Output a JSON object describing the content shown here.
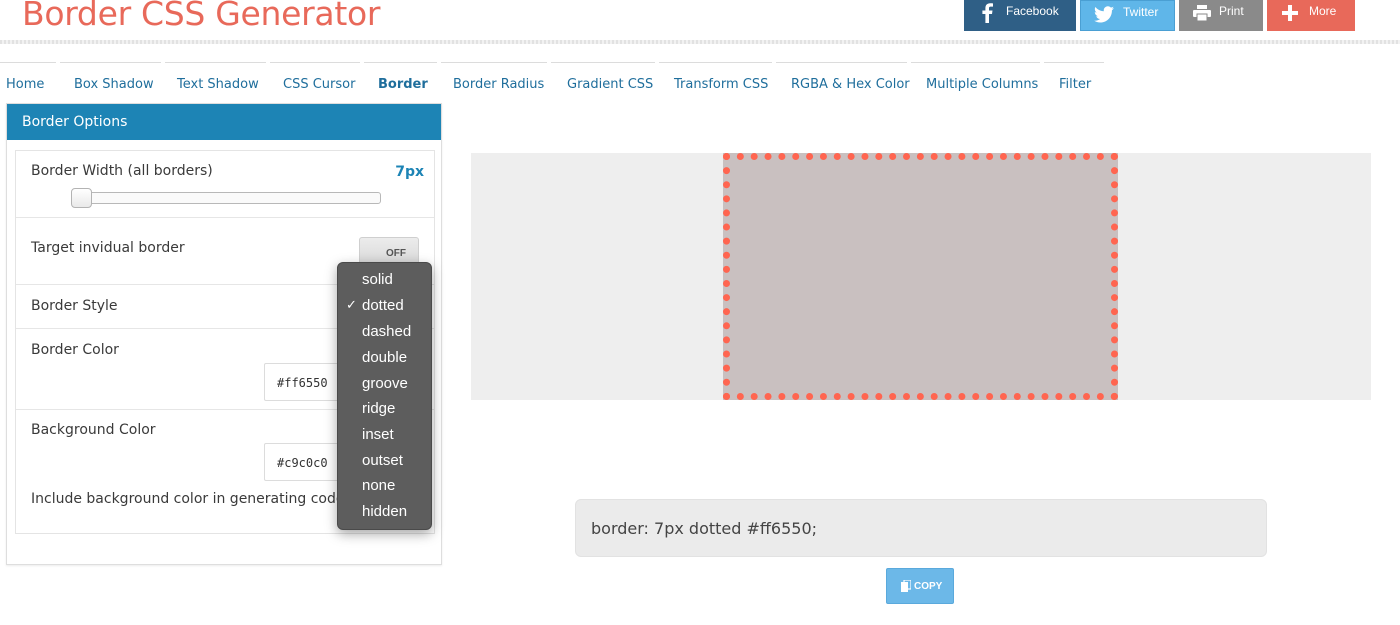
{
  "header": {
    "title": "Border CSS Generator"
  },
  "share": {
    "facebook": "Facebook",
    "twitter": "Twitter",
    "print": "Print",
    "more": "More"
  },
  "nav": {
    "items": [
      {
        "label": "Home"
      },
      {
        "label": "Box Shadow"
      },
      {
        "label": "Text Shadow"
      },
      {
        "label": "CSS Cursor"
      },
      {
        "label": "Border"
      },
      {
        "label": "Border Radius"
      },
      {
        "label": "Gradient CSS"
      },
      {
        "label": "Transform CSS"
      },
      {
        "label": "RGBA & Hex Color"
      },
      {
        "label": "Multiple Columns"
      },
      {
        "label": "Filter"
      }
    ],
    "active": "Border"
  },
  "panel": {
    "title": "Border Options",
    "border_width_label": "Border Width (all borders)",
    "border_width_value": "7px",
    "target_label": "Target invidual border",
    "toggle_state": "OFF",
    "border_style_label": "Border Style",
    "border_color_label": "Border Color",
    "border_color_value": "#ff6550",
    "background_color_label": "Background Color",
    "background_color_value": "#c9c0c0",
    "include_bg_label": "Include background color in generating code:"
  },
  "dropdown": {
    "selected": "dotted",
    "check": "✓",
    "options": [
      "solid",
      "dotted",
      "dashed",
      "double",
      "groove",
      "ridge",
      "inset",
      "outset",
      "none",
      "hidden"
    ]
  },
  "output": {
    "code": "border: 7px dotted #ff6550;",
    "copy_label": "COPY"
  },
  "colors": {
    "title": "#e8695a",
    "accent": "#1d84b5",
    "border_color": "#ff6550",
    "preview_bg": "#c9c0c0"
  }
}
